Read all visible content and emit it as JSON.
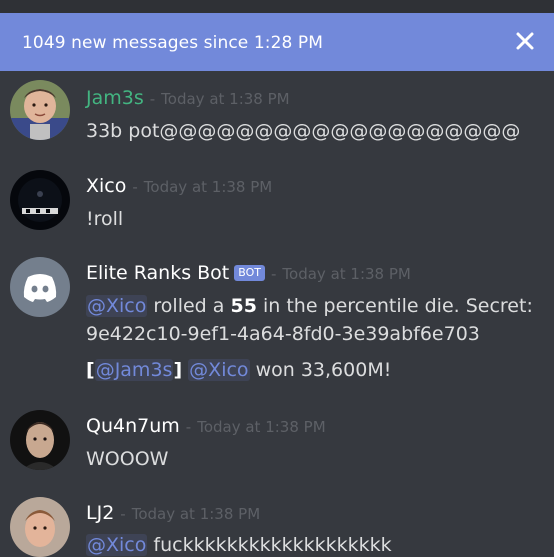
{
  "banner": {
    "text": "1049 new messages since 1:28 PM",
    "color": "#7289da"
  },
  "messages": [
    {
      "author": "Jam3s",
      "author_color": "#43b581",
      "separator": "-",
      "timestamp": "Today at 1:38 PM",
      "lines": [
        "33b pot@@@@@@@@@@@@@@@@@@@"
      ]
    },
    {
      "author": "Xico",
      "author_color": "#ffffff",
      "separator": "-",
      "timestamp": "Today at 1:38 PM",
      "lines": [
        "!roll"
      ]
    },
    {
      "author": "Elite Ranks Bot",
      "author_color": "#ffffff",
      "bot_tag": "BOT",
      "separator": "-",
      "timestamp": "Today at 1:38 PM",
      "line1": {
        "mention": "@Xico",
        "pre": " rolled a ",
        "number": "55",
        "post": " in the percentile die. Secret:"
      },
      "line2": "9e422c10-9ef1-4a64-8fd0-3e39abf6e703",
      "line3": {
        "open": "[",
        "mention1": "@Jam3s",
        "close": "]",
        "space": " ",
        "mention2": "@Xico",
        "post": " won 33,600M!"
      }
    },
    {
      "author": "Qu4n7um",
      "author_color": "#ffffff",
      "separator": "-",
      "timestamp": "Today at 1:38 PM",
      "lines": [
        "WOOOW"
      ]
    },
    {
      "author": "LJ2",
      "author_color": "#ffffff",
      "separator": "-",
      "timestamp": "Today at 1:38 PM",
      "line1": {
        "mention": "@Xico",
        "post": " fuckkkkkkkkkkkkkkkkkkk"
      }
    }
  ],
  "icons": {
    "close": "close-icon",
    "discord": "discord-logo-icon"
  }
}
